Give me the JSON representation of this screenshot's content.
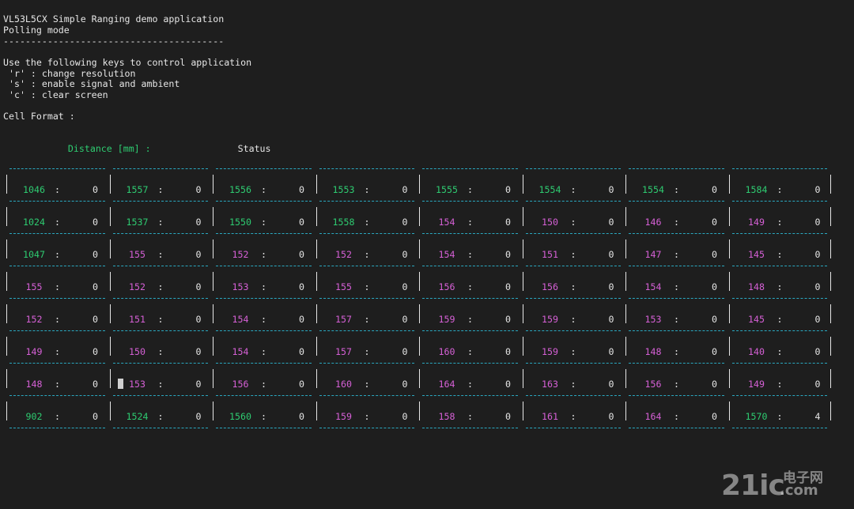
{
  "header": {
    "lines": [
      "VL53L5CX Simple Ranging demo application",
      "Polling mode",
      "----------------------------------------",
      "",
      "Use the following keys to control application",
      " 'r' : change resolution",
      " 's' : enable signal and ambient",
      " 'c' : clear screen",
      "",
      "Cell Format :"
    ]
  },
  "cell_format": {
    "distance_label": "Distance [mm] :",
    "status_label": "Status"
  },
  "grid": {
    "rows": [
      [
        [
          "1046",
          "0",
          "g"
        ],
        [
          "1557",
          "0",
          "g"
        ],
        [
          "1556",
          "0",
          "g"
        ],
        [
          "1553",
          "0",
          "g"
        ],
        [
          "1555",
          "0",
          "g"
        ],
        [
          "1554",
          "0",
          "g"
        ],
        [
          "1554",
          "0",
          "g"
        ],
        [
          "1584",
          "0",
          "g"
        ]
      ],
      [
        [
          "1024",
          "0",
          "g"
        ],
        [
          "1537",
          "0",
          "g"
        ],
        [
          "1550",
          "0",
          "g"
        ],
        [
          "1558",
          "0",
          "g"
        ],
        [
          "154",
          "0",
          "m"
        ],
        [
          "150",
          "0",
          "m"
        ],
        [
          "146",
          "0",
          "m"
        ],
        [
          "149",
          "0",
          "m"
        ]
      ],
      [
        [
          "1047",
          "0",
          "g"
        ],
        [
          "155",
          "0",
          "m"
        ],
        [
          "152",
          "0",
          "m"
        ],
        [
          "152",
          "0",
          "m"
        ],
        [
          "154",
          "0",
          "m"
        ],
        [
          "151",
          "0",
          "m"
        ],
        [
          "147",
          "0",
          "m"
        ],
        [
          "145",
          "0",
          "m"
        ]
      ],
      [
        [
          "155",
          "0",
          "m"
        ],
        [
          "152",
          "0",
          "m"
        ],
        [
          "153",
          "0",
          "m"
        ],
        [
          "155",
          "0",
          "m"
        ],
        [
          "156",
          "0",
          "m"
        ],
        [
          "156",
          "0",
          "m"
        ],
        [
          "154",
          "0",
          "m"
        ],
        [
          "148",
          "0",
          "m"
        ]
      ],
      [
        [
          "152",
          "0",
          "m"
        ],
        [
          "151",
          "0",
          "m"
        ],
        [
          "154",
          "0",
          "m"
        ],
        [
          "157",
          "0",
          "m"
        ],
        [
          "159",
          "0",
          "m"
        ],
        [
          "159",
          "0",
          "m"
        ],
        [
          "153",
          "0",
          "m"
        ],
        [
          "145",
          "0",
          "m"
        ]
      ],
      [
        [
          "149",
          "0",
          "m"
        ],
        [
          "150",
          "0",
          "m"
        ],
        [
          "154",
          "0",
          "m"
        ],
        [
          "157",
          "0",
          "m"
        ],
        [
          "160",
          "0",
          "m"
        ],
        [
          "159",
          "0",
          "m"
        ],
        [
          "148",
          "0",
          "m"
        ],
        [
          "140",
          "0",
          "m"
        ]
      ],
      [
        [
          "148",
          "0",
          "m"
        ],
        [
          "153",
          "0",
          "m"
        ],
        [
          "156",
          "0",
          "m"
        ],
        [
          "160",
          "0",
          "m"
        ],
        [
          "164",
          "0",
          "m"
        ],
        [
          "163",
          "0",
          "m"
        ],
        [
          "156",
          "0",
          "m"
        ],
        [
          "149",
          "0",
          "m"
        ]
      ],
      [
        [
          "902",
          "0",
          "g"
        ],
        [
          "1524",
          "0",
          "g"
        ],
        [
          "1560",
          "0",
          "g"
        ],
        [
          "159",
          "0",
          "m"
        ],
        [
          "158",
          "0",
          "m"
        ],
        [
          "161",
          "0",
          "m"
        ],
        [
          "164",
          "0",
          "m"
        ],
        [
          "1570",
          "4",
          "g"
        ]
      ]
    ],
    "cursor_position": {
      "row": 6,
      "col": 1
    }
  },
  "colors": {
    "background": "#1e1e1e",
    "text": "#e6e6e6",
    "distance_far": "#2ecc71",
    "distance_near": "#d660d6",
    "grid_dash": "#2aa8c0"
  },
  "watermark": {
    "main": "21ic",
    "cn": "电子网",
    "suffix": ".com"
  }
}
